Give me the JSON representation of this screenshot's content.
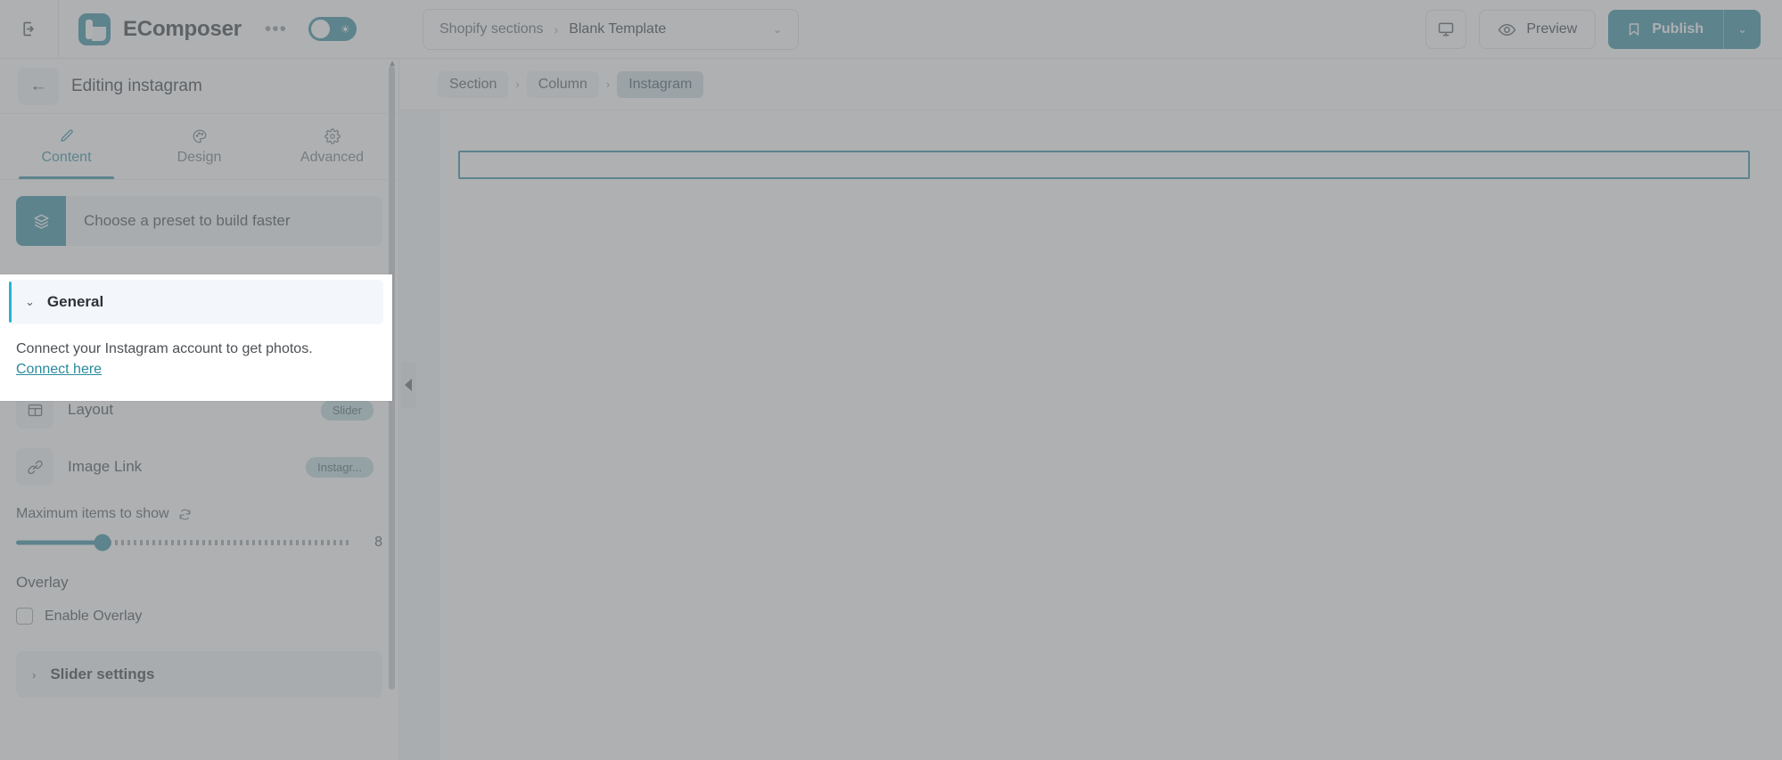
{
  "topbar": {
    "exit_icon": "exit-icon",
    "brand_name": "EComposer",
    "more_label": "•••",
    "theme_toggle_icon": "sun-icon",
    "template_picker": {
      "parent": "Shopify sections",
      "separator": "›",
      "current": "Blank Template",
      "chevron": "⌄"
    },
    "device_icon": "desktop-icon",
    "preview_label": "Preview",
    "preview_icon": "eye-icon",
    "publish_label": "Publish",
    "publish_icon": "bookmark-icon",
    "publish_caret": "⌄"
  },
  "sidebar": {
    "back_icon": "arrow-left-icon",
    "title": "Editing instagram",
    "tabs": [
      {
        "label": "Content",
        "icon": "pencil-icon",
        "active": true
      },
      {
        "label": "Design",
        "icon": "palette-icon",
        "active": false
      },
      {
        "label": "Advanced",
        "icon": "gear-icon",
        "active": false
      }
    ],
    "preset": {
      "icon": "layers-icon",
      "label": "Choose a preset to build faster"
    },
    "general": {
      "chevron": "⌄",
      "label": "General",
      "description": "Connect your Instagram account to get photos.",
      "link_label": "Connect here"
    },
    "options": [
      {
        "icon": "layout-icon",
        "label": "Layout",
        "badge": "Slider"
      },
      {
        "icon": "link-icon",
        "label": "Image Link",
        "badge": "Instagr..."
      }
    ],
    "max_items": {
      "label": "Maximum items to show",
      "reset_icon": "refresh-icon",
      "value": "8",
      "fill_percent": 26
    },
    "overlay": {
      "group_title": "Overlay",
      "checkbox_label": "Enable Overlay",
      "checked": false
    },
    "slider_settings": {
      "chevron": "›",
      "label": "Slider settings"
    }
  },
  "canvas": {
    "breadcrumb": [
      {
        "label": "Section",
        "current": false
      },
      {
        "label": "Column",
        "current": false
      },
      {
        "label": "Instagram",
        "current": true
      }
    ],
    "separator": "›",
    "collapse_icon": "triangle-left-icon"
  },
  "colors": {
    "accent": "#2a8a9b",
    "accent_light": "#bcd7dc",
    "highlight_border": "#27b5d4",
    "crumb_current_bg": "#cfdee1",
    "panel_bg": "#f2f4f5"
  }
}
